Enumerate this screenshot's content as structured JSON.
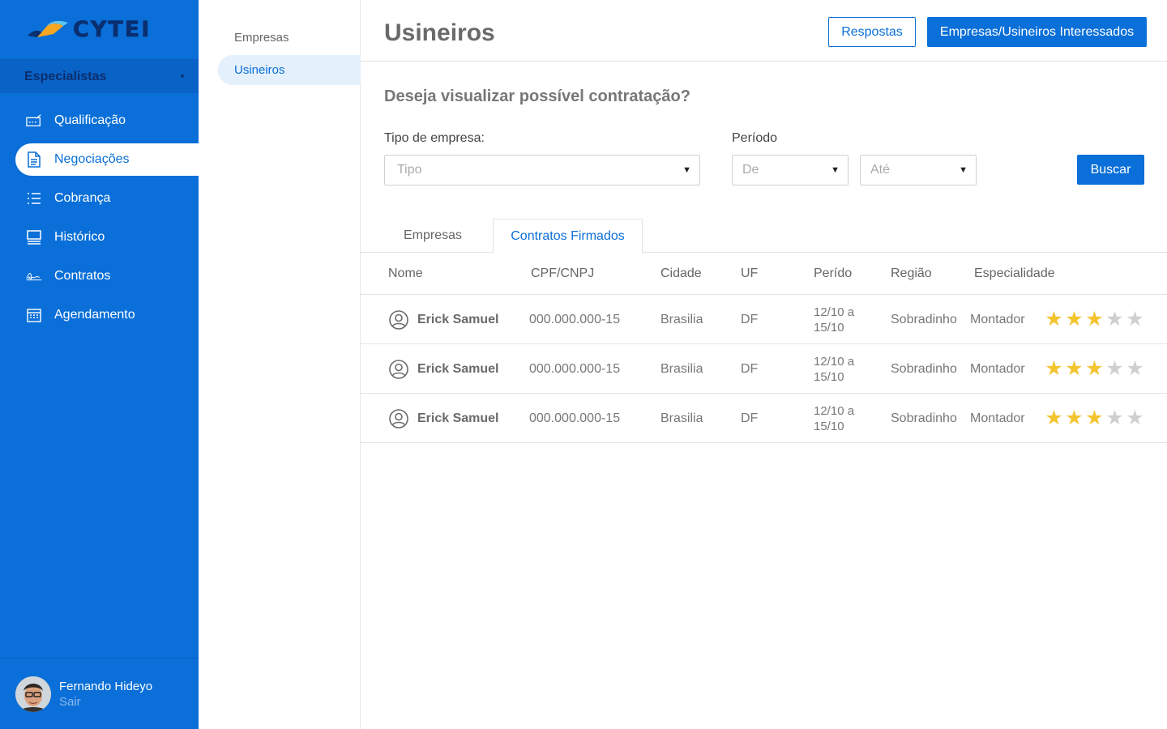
{
  "brand": {
    "name": "CYTEI"
  },
  "sidebar": {
    "section": "Especialistas",
    "items": [
      {
        "label": "Qualificação",
        "icon": "qualification-icon"
      },
      {
        "label": "Negociações",
        "icon": "document-icon",
        "active": true
      },
      {
        "label": "Cobrança",
        "icon": "list-icon"
      },
      {
        "label": "Histórico",
        "icon": "history-icon"
      },
      {
        "label": "Contratos",
        "icon": "signature-icon"
      },
      {
        "label": "Agendamento",
        "icon": "calendar-icon"
      }
    ],
    "user": {
      "name": "Fernando Hideyo",
      "logout": "Sair"
    }
  },
  "subnav": {
    "items": [
      {
        "label": "Empresas"
      },
      {
        "label": "Usineiros",
        "active": true
      }
    ]
  },
  "header": {
    "title": "Usineiros",
    "btn_respostas": "Respostas",
    "btn_interessados": "Empresas/Usineiros Interessados"
  },
  "filters": {
    "question": "Deseja visualizar possível contratação?",
    "tipo_label": "Tipo de empresa:",
    "tipo_placeholder": "Tipo",
    "periodo_label": "Período",
    "de_placeholder": "De",
    "ate_placeholder": "Até",
    "search_label": "Buscar"
  },
  "tabs": [
    {
      "label": "Empresas"
    },
    {
      "label": "Contratos Firmados",
      "active": true
    }
  ],
  "table": {
    "columns": [
      "Nome",
      "CPF/CNPJ",
      "Cidade",
      "UF",
      "Perído",
      "Região",
      "Especialidade"
    ],
    "rows": [
      {
        "nome": "Erick Samuel",
        "cpf": "000.000.000-15",
        "cidade": "Brasilia",
        "uf": "DF",
        "periodo_1": "12/10 a",
        "periodo_2": "15/10",
        "regiao": "Sobradinho",
        "especialidade": "Montador",
        "rating": 3,
        "rating_max": 5
      },
      {
        "nome": "Erick Samuel",
        "cpf": "000.000.000-15",
        "cidade": "Brasilia",
        "uf": "DF",
        "periodo_1": "12/10 a",
        "periodo_2": "15/10",
        "regiao": "Sobradinho",
        "especialidade": "Montador",
        "rating": 3,
        "rating_max": 5
      },
      {
        "nome": "Erick Samuel",
        "cpf": "000.000.000-15",
        "cidade": "Brasilia",
        "uf": "DF",
        "periodo_1": "12/10 a",
        "periodo_2": "15/10",
        "regiao": "Sobradinho",
        "especialidade": "Montador",
        "rating": 3,
        "rating_max": 5
      }
    ]
  },
  "colors": {
    "primary": "#0a6fd8",
    "star_on": "#f4c430",
    "star_off": "#cfcfcf"
  }
}
